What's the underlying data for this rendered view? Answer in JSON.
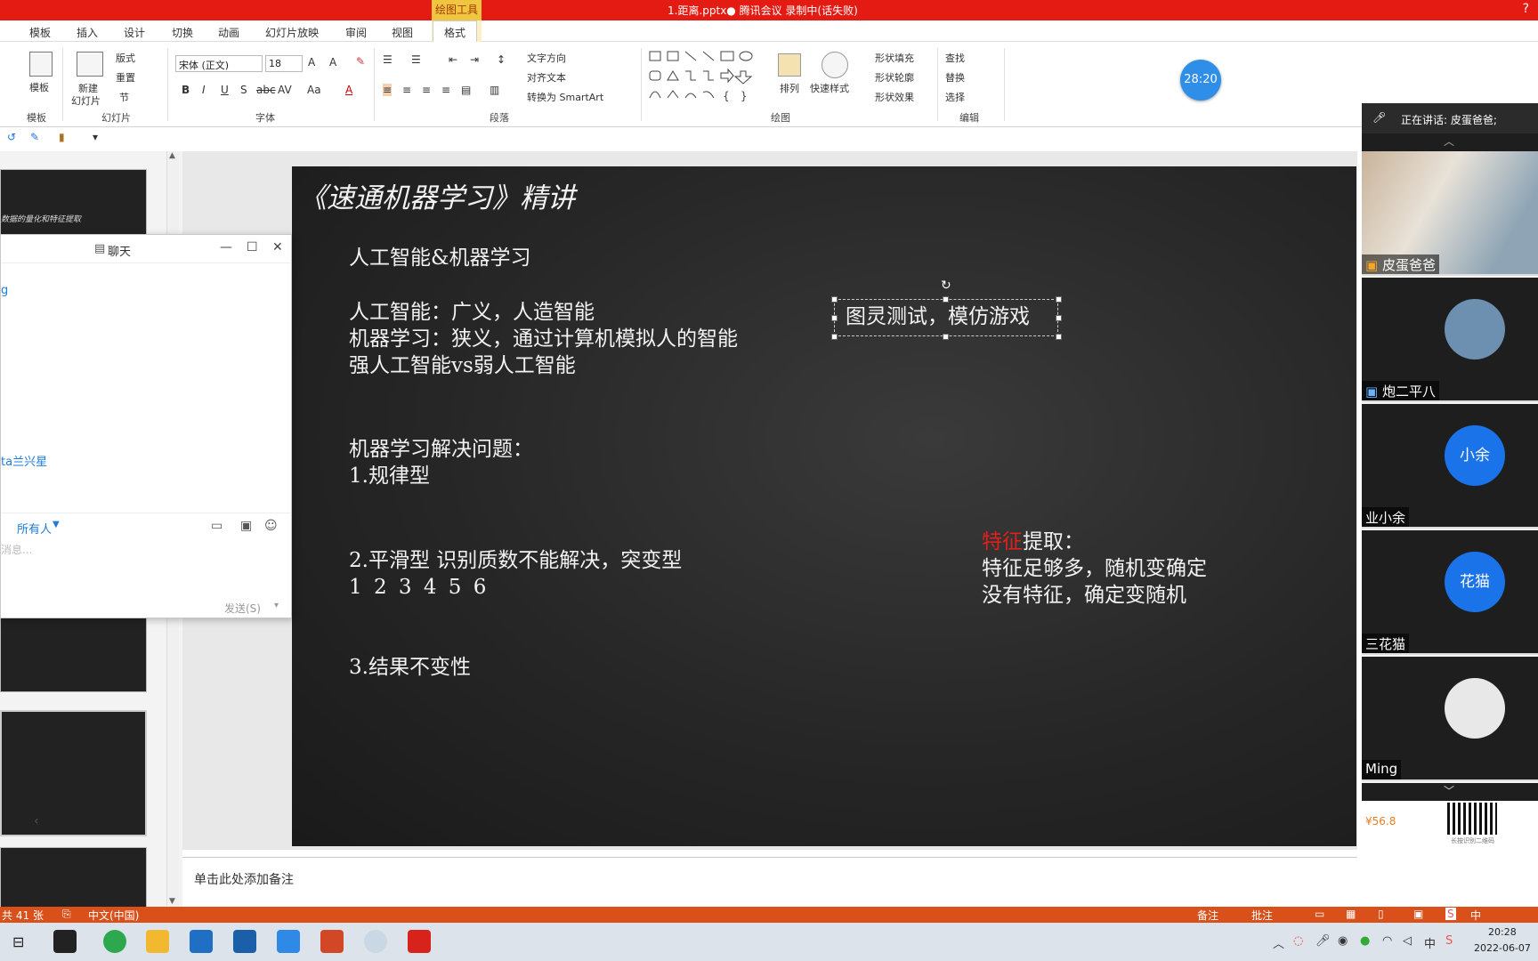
{
  "titlebar": {
    "title": "1.距离.pptx● 腾讯会议 录制中(话失败)",
    "context_tab": "绘图工具",
    "help": "?"
  },
  "tabs": [
    "模板",
    "插入",
    "设计",
    "切换",
    "动画",
    "幻灯片放映",
    "审阅",
    "视图",
    "格式"
  ],
  "ribbon": {
    "template_btn": "模板",
    "template_group": "模板",
    "new_slide": "新建",
    "new_slide2": "幻灯片",
    "layout": "版式",
    "reset": "重置",
    "section": "节",
    "slides_group": "幻灯片",
    "font_name": "宋体 (正文)",
    "font_size": "18",
    "font_group": "字体",
    "text_dir": "文字方向",
    "align_text": "对齐文本",
    "smartart": "转换为 SmartArt",
    "para_group": "段落",
    "arrange": "排列",
    "quick_style": "快速样式",
    "shape_fill": "形状填充",
    "shape_outline": "形状轮廓",
    "shape_effect": "形状效果",
    "draw_group": "绘图",
    "find": "查找",
    "replace": "替换",
    "select": "选择",
    "edit_group": "编辑",
    "timer": "28:20"
  },
  "thumbs": {
    "first_caption": "数据的量化和特征提取"
  },
  "chat": {
    "title": "聊天",
    "lines": [
      "g",
      "ta兰兴星"
    ],
    "to_label": "所有人",
    "placeholder": "消息...",
    "send": "发送(S)"
  },
  "slide": {
    "title": "《速通机器学习》精讲",
    "line1": "人工智能&机器学习",
    "line2": "人工智能：广义，人造智能",
    "line3": "机器学习：狭义，通过计算机模拟人的智能",
    "line4": "强人工智能vs弱人工智能",
    "line5": "机器学习解决问题：",
    "line6": "1.规律型",
    "line7": "2.平滑型 识别质数不能解决，突变型",
    "line8": "1 2 3 4 5 6",
    "line9": "3.结果不变性",
    "box": "图灵测试，模仿游戏",
    "feat_red": "特征",
    "feat_rest": "提取：",
    "feat2": "特征足够多，随机变确定",
    "feat3": "没有特征，确定变随机",
    "accent_red": "#e0201b"
  },
  "notes": {
    "placeholder": "单击此处添加备注"
  },
  "status": {
    "slides": "共 41 张",
    "lang": "中文(中国)",
    "notes": "备注",
    "comments": "批注"
  },
  "meeting": {
    "speaking": "正在讲话: 皮蛋爸爸;",
    "participants": [
      {
        "name": "皮蛋爸爸",
        "avatar": ""
      },
      {
        "name": "炮二平八",
        "avatar": ""
      },
      {
        "name": "业小余",
        "avatar": "小余"
      },
      {
        "name": "三花猫",
        "avatar": "花猫"
      },
      {
        "name": "Ming",
        "avatar": ""
      }
    ],
    "price": "¥56.8",
    "qr_caption": "长按识别二维码"
  },
  "taskbar": {
    "time": "20:28",
    "date": "2022-06-07",
    "ime": "中"
  }
}
